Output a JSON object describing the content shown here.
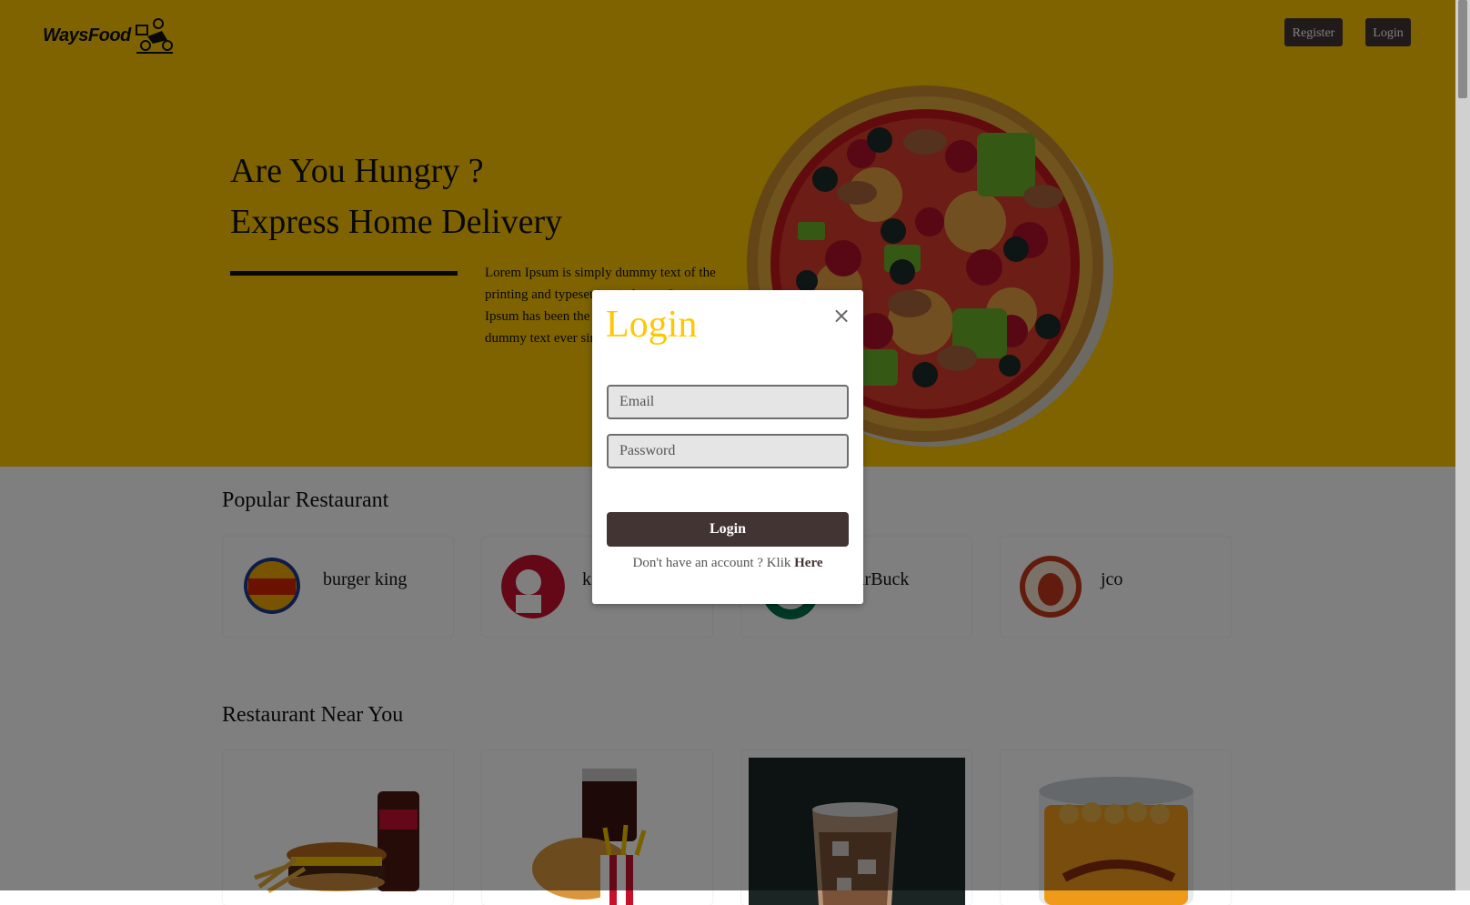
{
  "header": {
    "brand": "WaysFood",
    "brand_icon": "delivery-scooter-icon",
    "register_label": "Register",
    "login_label": "Login"
  },
  "hero": {
    "title_line1": "Are You Hungry ?",
    "title_line2": "Express Home Delivery",
    "description": "Lorem Ipsum is simply dummy text of the printing and typesetting industry. Lorem Ipsum has been the industry's standard dummy text ever since the 1500s.",
    "image": "pizza-illustration"
  },
  "popular": {
    "title": "Popular Restaurant",
    "restaurants": [
      {
        "name": "burger king",
        "logo": "burger-king-logo"
      },
      {
        "name": "kfc",
        "logo": "kfc-logo"
      },
      {
        "name": "StarBuck",
        "logo": "starbucks-logo"
      },
      {
        "name": "jco",
        "logo": "jco-logo"
      }
    ]
  },
  "near": {
    "title": "Restaurant Near You",
    "items": [
      {
        "image": "burger-meal-photo"
      },
      {
        "image": "kfc-meal-photo"
      },
      {
        "image": "iced-coffee-photo"
      },
      {
        "image": "jco-donut-box-photo"
      }
    ]
  },
  "modal": {
    "title": "Login",
    "close_icon": "close-icon",
    "email_placeholder": "Email",
    "password_placeholder": "Password",
    "submit_label": "Login",
    "footer_text": "Don't have an account ? Klik ",
    "footer_link": "Here"
  },
  "colors": {
    "primary_yellow": "#FFC700",
    "dark_brown": "#433434"
  }
}
